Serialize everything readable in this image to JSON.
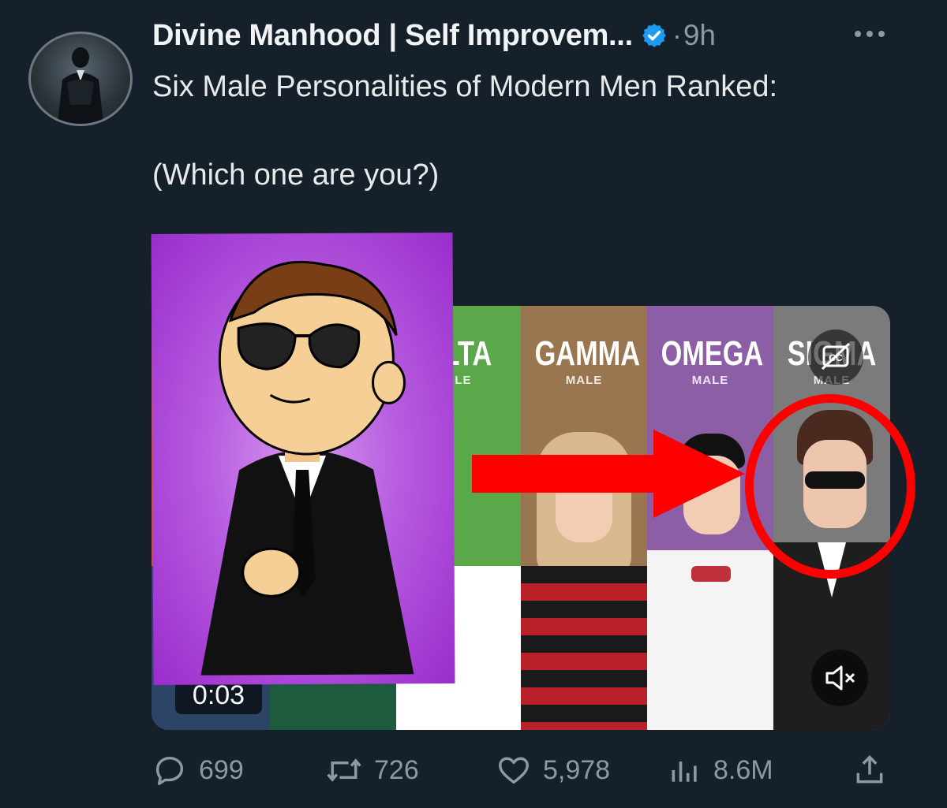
{
  "tweet": {
    "author": {
      "display_name": "Divine Manhood | Self Improvem...",
      "verified_icon": "verified-badge-icon",
      "separator": "·",
      "time": "9h"
    },
    "more_icon": "more-horizontal-icon",
    "text_line1": "Six Male Personalities of Modern Men Ranked:",
    "text_line2": "(Which one are you?)"
  },
  "media": {
    "panels": [
      {
        "title": "",
        "subtitle": "",
        "color": "#c9543a"
      },
      {
        "title": "ELTA",
        "subtitle": "ALE",
        "color": "#5aa84a"
      },
      {
        "title": "GAMMA",
        "subtitle": "MALE",
        "color": "#9a7650"
      },
      {
        "title": "OMEGA",
        "subtitle": "MALE",
        "color": "#8c5ea6"
      },
      {
        "title": "SIGMA",
        "subtitle": "MALE",
        "color": "#7b7b7b"
      }
    ],
    "timer": "0:03",
    "cc_icon": "closed-captions-off-icon",
    "mute_icon": "speaker-muted-icon"
  },
  "annotations": {
    "arrow_color": "#ff0000",
    "circle_color": "#ff0000"
  },
  "actions": {
    "replies": {
      "icon": "reply-icon",
      "count": "699"
    },
    "reposts": {
      "icon": "repost-icon",
      "count": "726"
    },
    "likes": {
      "icon": "heart-icon",
      "count": "5,978"
    },
    "views": {
      "icon": "views-chart-icon",
      "count": "8.6M"
    },
    "share": {
      "icon": "share-icon"
    }
  },
  "colors": {
    "background": "#16202a",
    "verified": "#1d9bf0",
    "secondary_text": "#8b98a5",
    "overlay_purple": "#b75de0"
  }
}
